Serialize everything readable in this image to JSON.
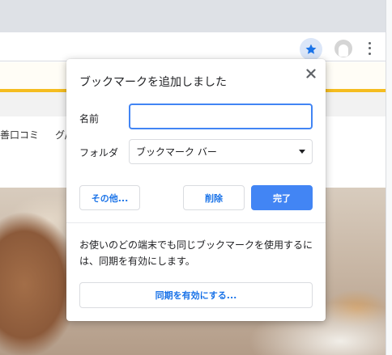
{
  "browser": {
    "bookmark_star_icon": "star-icon",
    "profile_icon": "avatar",
    "menu_icon": "three-dots-vertical-icon",
    "accent_color": "#4285f4"
  },
  "page": {
    "links": [
      "善口コミ",
      "グ/"
    ]
  },
  "dialog": {
    "title": "ブックマークを追加しました",
    "close_icon": "close-icon",
    "name_label": "名前",
    "name_value": "",
    "folder_label": "フォルダ",
    "folder_value": "ブックマーク バー",
    "more_button": "その他...",
    "remove_button": "削除",
    "done_button": "完了",
    "sync_message": "お使いのどの端末でも同じブックマークを使用するには、同期を有効にします。",
    "sync_button": "同期を有効にする..."
  }
}
